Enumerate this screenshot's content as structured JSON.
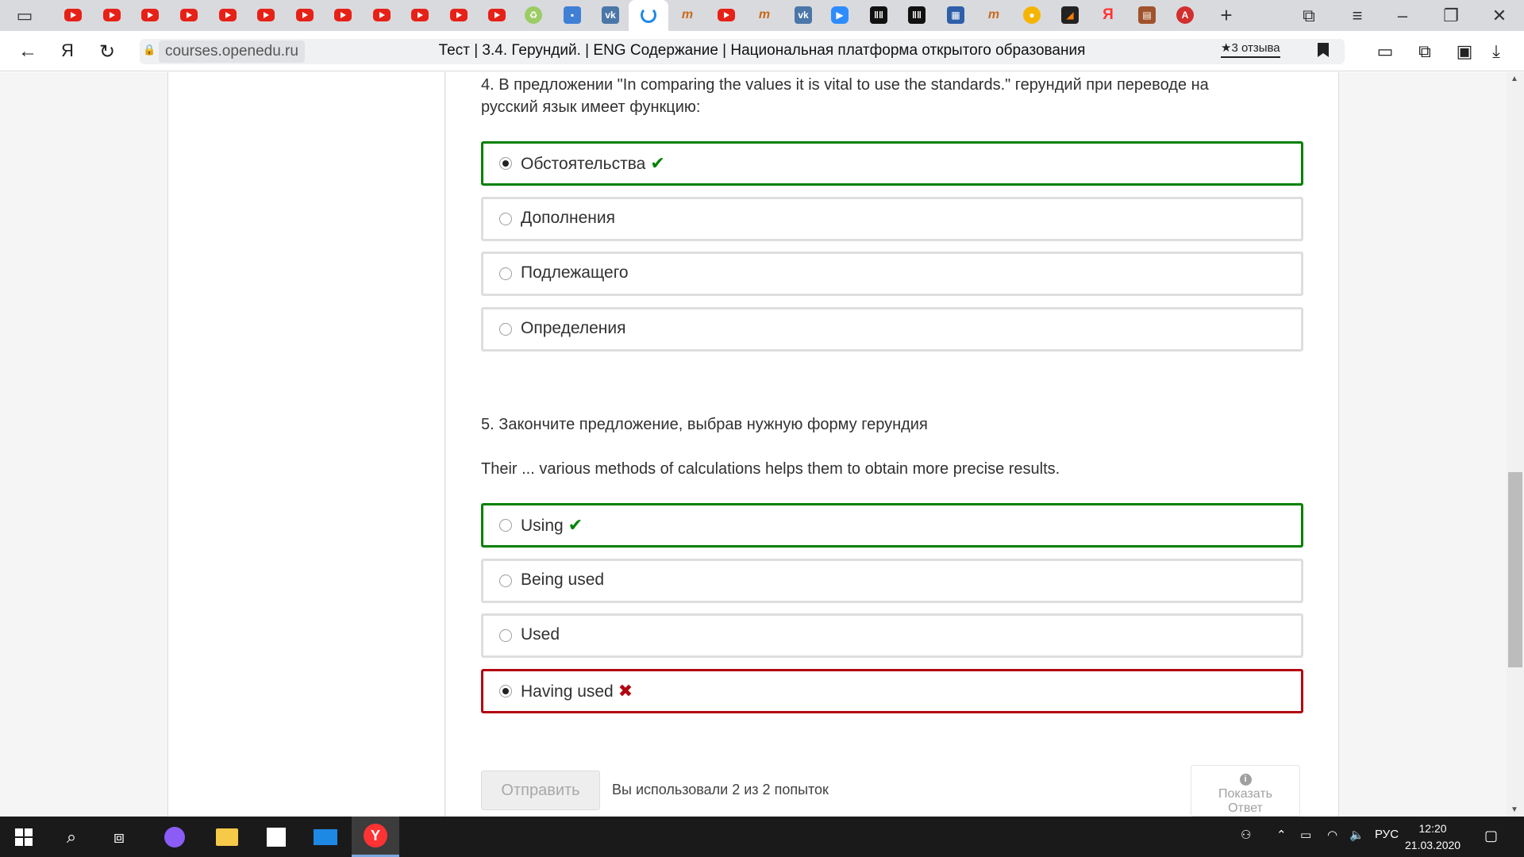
{
  "browser": {
    "tabs": [
      {
        "icon": "youtube-icon"
      },
      {
        "icon": "youtube-icon"
      },
      {
        "icon": "youtube-icon"
      },
      {
        "icon": "youtube-icon"
      },
      {
        "icon": "youtube-icon"
      },
      {
        "icon": "youtube-icon"
      },
      {
        "icon": "youtube-icon"
      },
      {
        "icon": "youtube-icon"
      },
      {
        "icon": "youtube-icon"
      },
      {
        "icon": "youtube-icon"
      },
      {
        "icon": "youtube-icon"
      },
      {
        "icon": "youtube-icon"
      },
      {
        "icon": "recycle-icon"
      },
      {
        "icon": "chat-icon"
      },
      {
        "icon": "vk-icon"
      },
      {
        "icon": "loading-spinner-icon",
        "active": true
      },
      {
        "icon": "m-icon"
      },
      {
        "icon": "youtube-icon"
      },
      {
        "icon": "m-icon"
      },
      {
        "icon": "vk-icon"
      },
      {
        "icon": "zoom-icon"
      },
      {
        "icon": "piano-icon"
      },
      {
        "icon": "piano-icon"
      },
      {
        "icon": "book-icon"
      },
      {
        "icon": "m-icon"
      },
      {
        "icon": "cloud-icon"
      },
      {
        "icon": "orange-icon"
      },
      {
        "icon": "yandex-icon"
      },
      {
        "icon": "brown-icon"
      },
      {
        "icon": "notification-icon"
      }
    ],
    "address": {
      "domain": "courses.openedu.ru",
      "title": "Тест | 3.4. Герундий. | ENG Содержание | Национальная платформа открытого образования",
      "reviews": "★3 отзыва"
    }
  },
  "quiz": {
    "q4": {
      "text_line1": "4. В предложении \"In comparing the values it is vital to use the standards.\" герундий при переводе на",
      "text_line2": "русский язык имеет функцию:",
      "options": [
        {
          "label": "Обстоятельства",
          "checked": true,
          "status": "correct"
        },
        {
          "label": "Дополнения",
          "checked": false,
          "status": "none"
        },
        {
          "label": "Подлежащего",
          "checked": false,
          "status": "none"
        },
        {
          "label": "Определения",
          "checked": false,
          "status": "none"
        }
      ]
    },
    "q5": {
      "text": "5. Закончите предложение, выбрав нужную форму герундия",
      "sentence": "Their ... various methods of calculations helps them to obtain more precise results.",
      "options": [
        {
          "label": "Using",
          "checked": false,
          "status": "correct"
        },
        {
          "label": "Being used",
          "checked": false,
          "status": "none"
        },
        {
          "label": "Used",
          "checked": false,
          "status": "none"
        },
        {
          "label": "Having used",
          "checked": true,
          "status": "incorrect"
        }
      ]
    },
    "submit_label": "Отправить",
    "attempts_text": "Вы использовали 2 из 2 попыток",
    "show_answer_line1": "Показать",
    "show_answer_line2": "Ответ",
    "marks": {
      "correct": "✔",
      "incorrect": "✖"
    }
  },
  "taskbar": {
    "language": "РУС",
    "time": "12:20",
    "date": "21.03.2020"
  }
}
